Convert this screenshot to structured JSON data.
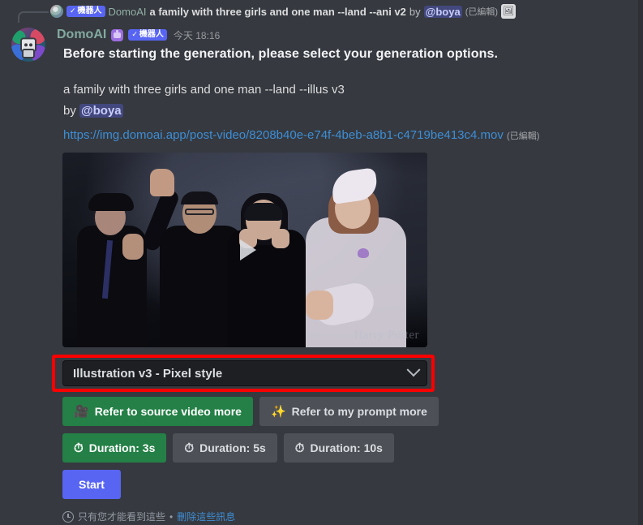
{
  "reply_bar": {
    "bot_badge_check": "✓",
    "bot_badge_label": "機器人",
    "author": "DomoAI",
    "message_preview": "a family with three girls and one man --land --ani v2",
    "by_word": "by",
    "mention": "@boya",
    "edited": "(已編輯)",
    "attachment_icon": "🖼"
  },
  "message": {
    "username": "DomoAI",
    "bot_badge_check": "✓",
    "bot_badge_label": "機器人",
    "timestamp": "今天 18:16",
    "headline": "Before starting the generation, please select your generation options.",
    "prompt": "a family with three girls and one man --land --illus v3",
    "by_word": "by",
    "mention": "@boya",
    "url": "https://img.domoai.app/post-video/8208b40e-e74f-4beb-a8b1-c4719be413c4.mov",
    "url_edited": "(已編輯)"
  },
  "video": {
    "watermark": "Harry Potter",
    "play_label": "play"
  },
  "style_select": {
    "value": "Illustration v3 - Pixel style",
    "chevron": "chevron-down"
  },
  "refer_buttons": [
    {
      "emoji": "🎥",
      "label": "Refer to source video more",
      "state": "active"
    },
    {
      "emoji": "✨",
      "label": "Refer to my prompt more",
      "state": "inactive"
    }
  ],
  "duration_buttons": [
    {
      "emoji": "⏱",
      "label": "Duration: 3s",
      "state": "active"
    },
    {
      "emoji": "⏱",
      "label": "Duration: 5s",
      "state": "inactive"
    },
    {
      "emoji": "⏱",
      "label": "Duration: 10s",
      "state": "inactive"
    }
  ],
  "start_button": {
    "label": "Start"
  },
  "footer": {
    "ephemeral_text": "只有您才能看到這些",
    "separator": "•",
    "delete_link": "刪除這些訊息"
  },
  "colors": {
    "background": "#36393f",
    "green": "#248046",
    "grey": "#4e5058",
    "blurple": "#5865f2",
    "link": "#3d8ed6",
    "highlight_red": "#fb0000"
  }
}
